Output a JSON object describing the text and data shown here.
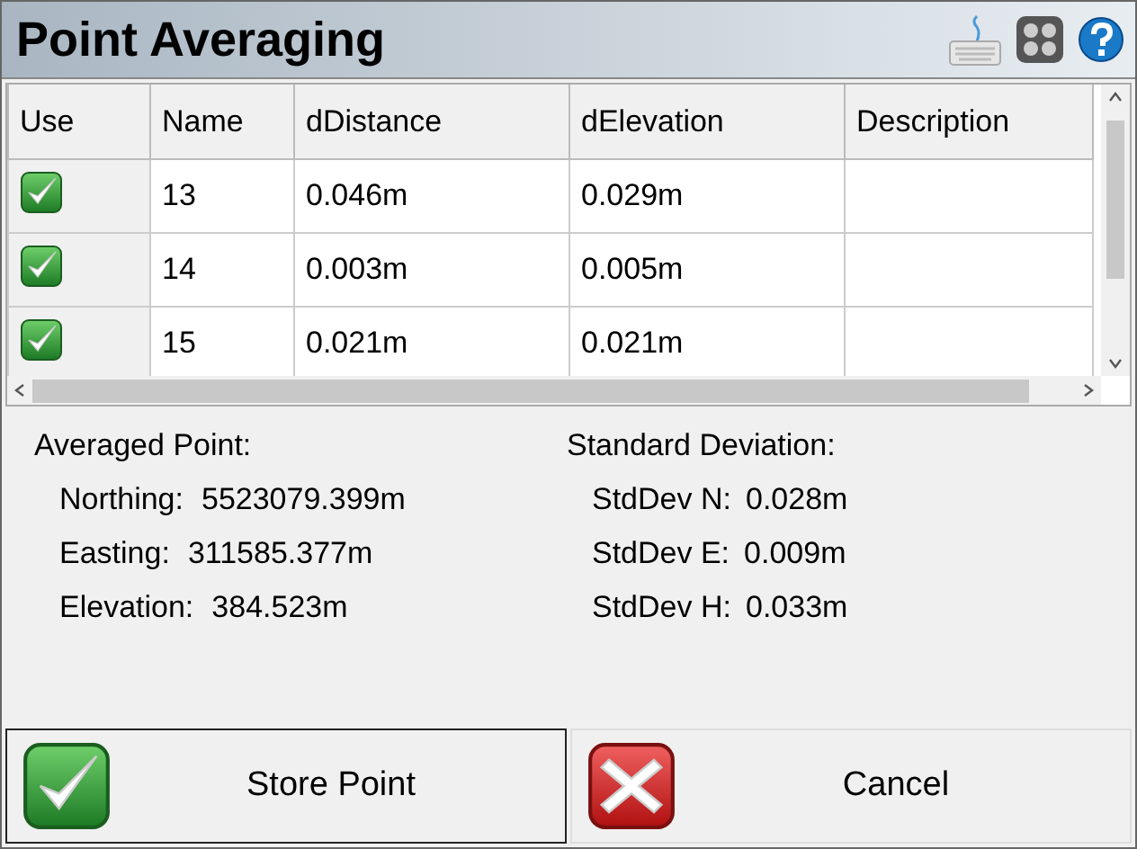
{
  "window": {
    "title": "Point Averaging"
  },
  "table": {
    "columns": [
      "Use",
      "Name",
      "dDistance",
      "dElevation",
      "Description"
    ],
    "rows": [
      {
        "checked": true,
        "name": "13",
        "d_distance": "0.046m",
        "d_elevation": "0.029m"
      },
      {
        "checked": true,
        "name": "14",
        "d_distance": "0.003m",
        "d_elevation": "0.005m"
      },
      {
        "checked": true,
        "name": "15",
        "d_distance": "0.021m",
        "d_elevation": "0.021m"
      }
    ]
  },
  "averaged_point": {
    "heading": "Averaged Point:",
    "fields": [
      {
        "label": "Northing:",
        "value": "5523079.399m"
      },
      {
        "label": "Easting:",
        "value": "311585.377m"
      },
      {
        "label": "Elevation:",
        "value": "384.523m"
      }
    ]
  },
  "standard_deviation": {
    "heading": "Standard Deviation:",
    "fields": [
      {
        "label": "StdDev N:",
        "value": "0.028m"
      },
      {
        "label": "StdDev E:",
        "value": "0.009m"
      },
      {
        "label": "StdDev H:",
        "value": "0.033m"
      }
    ]
  },
  "buttons": [
    {
      "label": "Store Point",
      "kind": "ok",
      "focused": true
    },
    {
      "label": "Cancel",
      "kind": "cancel",
      "focused": false
    }
  ]
}
